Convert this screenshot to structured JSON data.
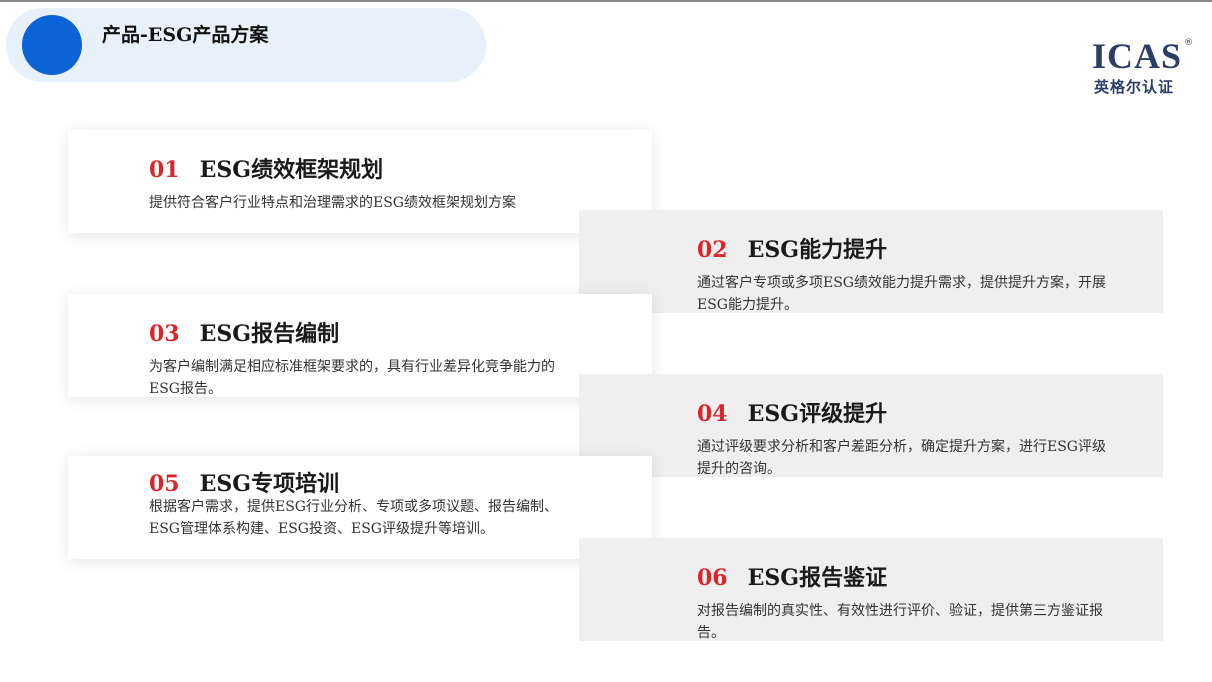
{
  "header": {
    "title": "产品-ESG产品方案"
  },
  "logo": {
    "word": "ICAS",
    "reg": "®",
    "cn": "英格尔认证"
  },
  "colors": {
    "accent_blue": "#0b63d6",
    "number_red": "#d9262c",
    "logo_navy": "#2b3f66",
    "pill_bg": "#e8f1fb",
    "gray_card": "#efefef"
  },
  "cards": [
    {
      "num": "01",
      "title": "ESG绩效框架规划",
      "desc": "提供符合客户行业特点和治理需求的ESG绩效框架规划方案"
    },
    {
      "num": "02",
      "title": "ESG能力提升",
      "desc": "通过客户专项或多项ESG绩效能力提升需求，提供提升方案，开展ESG能力提升。"
    },
    {
      "num": "03",
      "title": "ESG报告编制",
      "desc": "为客户编制满足相应标准框架要求的，具有行业差异化竞争能力的ESG报告。"
    },
    {
      "num": "04",
      "title": "ESG评级提升",
      "desc": "通过评级要求分析和客户差距分析，确定提升方案，进行ESG评级提升的咨询。"
    },
    {
      "num": "05",
      "title": "ESG专项培训",
      "desc": "根据客户需求，提供ESG行业分析、专项或多项议题、报告编制、ESG管理体系构建、ESG投资、ESG评级提升等培训。"
    },
    {
      "num": "06",
      "title": "ESG报告鉴证",
      "desc": "对报告编制的真实性、有效性进行评价、验证，提供第三方鉴证报告。"
    }
  ]
}
